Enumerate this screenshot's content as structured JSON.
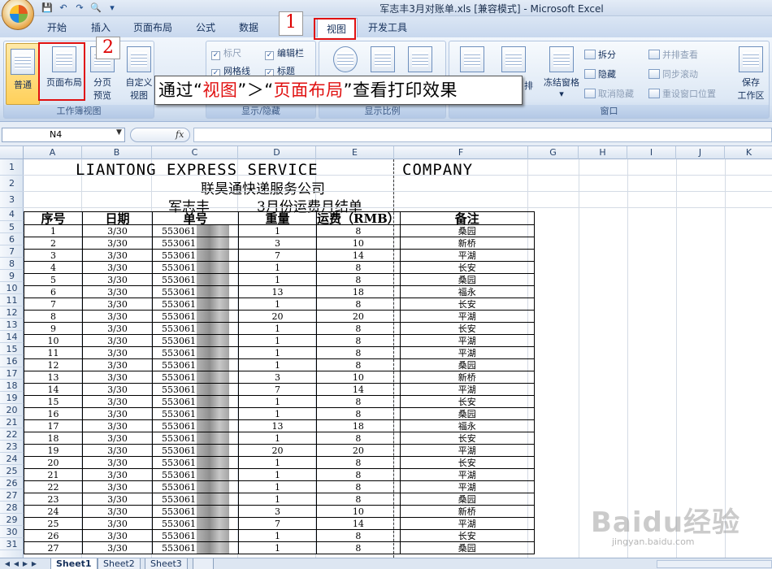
{
  "window": {
    "title": "军志丰3月对账单.xls  [兼容模式] - Microsoft Excel"
  },
  "quick_access": [
    "save-icon",
    "undo-icon",
    "redo-icon",
    "print-preview-icon"
  ],
  "tabs": [
    {
      "label": "开始"
    },
    {
      "label": "插入"
    },
    {
      "label": "页面布局"
    },
    {
      "label": "公式"
    },
    {
      "label": "数据"
    },
    {
      "label": "视图",
      "active": true
    },
    {
      "label": "开发工具"
    }
  ],
  "ribbon": {
    "groups": {
      "workbook_views": "工作簿视图",
      "show_hide": "显示/隐藏",
      "zoom": "显示比例",
      "window": "窗口"
    },
    "normal": "普通",
    "page_layout": "页面布局",
    "page_break_1": "分页",
    "page_break_2": "预览",
    "custom_1": "自定义",
    "custom_2": "视图",
    "ruler": "标尺",
    "formula_bar": "编辑栏",
    "gridlines": "网格线",
    "headings": "标题",
    "freeze": "冻结窗格",
    "arrange": "排",
    "split": "拆分",
    "hide": "隐藏",
    "unhide": "取消隐藏",
    "side_by_side": "并排查看",
    "sync_scroll": "同步滚动",
    "reset_pos": "重设窗口位置",
    "save_1": "保存",
    "save_2": "工作区"
  },
  "callouts": {
    "step1": "1",
    "step2": "2",
    "banner_pre": "通过“",
    "banner_hl1": "视图",
    "banner_mid": "”＞“",
    "banner_hl2": "页面布局",
    "banner_post": "”查看打印效果"
  },
  "formula_bar": {
    "name_box": "N4",
    "fx": "fx"
  },
  "columns": [
    "A",
    "B",
    "C",
    "D",
    "E",
    "F",
    "G",
    "H",
    "I",
    "J",
    "K"
  ],
  "sheet": {
    "title_en_left": "LIANTONG   EXPRESS   SERVICE",
    "title_en_right": "COMPANY",
    "title_cn": "联昊通快递服务公司",
    "subtitle_name": "军志丰",
    "subtitle_month": "3月份运费月结单",
    "headers": [
      "序号",
      "日期",
      "单号",
      "重量",
      "运费（RMB）",
      "备注"
    ],
    "rows": [
      [
        "1",
        "3/30",
        "553061",
        "1",
        "8",
        "桑园"
      ],
      [
        "2",
        "3/30",
        "553061",
        "3",
        "10",
        "新桥"
      ],
      [
        "3",
        "3/30",
        "553061",
        "7",
        "14",
        "平湖"
      ],
      [
        "4",
        "3/30",
        "553061",
        "1",
        "8",
        "长安"
      ],
      [
        "5",
        "3/30",
        "553061",
        "1",
        "8",
        "桑园"
      ],
      [
        "6",
        "3/30",
        "553061",
        "13",
        "18",
        "福永"
      ],
      [
        "7",
        "3/30",
        "553061",
        "1",
        "8",
        "长安"
      ],
      [
        "8",
        "3/30",
        "553061",
        "20",
        "20",
        "平湖"
      ],
      [
        "9",
        "3/30",
        "553061",
        "1",
        "8",
        "长安"
      ],
      [
        "10",
        "3/30",
        "553061",
        "1",
        "8",
        "平湖"
      ],
      [
        "11",
        "3/30",
        "553061",
        "1",
        "8",
        "平湖"
      ],
      [
        "12",
        "3/30",
        "553061",
        "1",
        "8",
        "桑园"
      ],
      [
        "13",
        "3/30",
        "553061",
        "3",
        "10",
        "新桥"
      ],
      [
        "14",
        "3/30",
        "553061",
        "7",
        "14",
        "平湖"
      ],
      [
        "15",
        "3/30",
        "553061",
        "1",
        "8",
        "长安"
      ],
      [
        "16",
        "3/30",
        "553061",
        "1",
        "8",
        "桑园"
      ],
      [
        "17",
        "3/30",
        "553061",
        "13",
        "18",
        "福永"
      ],
      [
        "18",
        "3/30",
        "553061",
        "1",
        "8",
        "长安"
      ],
      [
        "19",
        "3/30",
        "553061",
        "20",
        "20",
        "平湖"
      ],
      [
        "20",
        "3/30",
        "553061",
        "1",
        "8",
        "长安"
      ],
      [
        "21",
        "3/30",
        "553061",
        "1",
        "8",
        "平湖"
      ],
      [
        "22",
        "3/30",
        "553061",
        "1",
        "8",
        "平湖"
      ],
      [
        "23",
        "3/30",
        "553061",
        "1",
        "8",
        "桑园"
      ],
      [
        "24",
        "3/30",
        "553061",
        "3",
        "10",
        "新桥"
      ],
      [
        "25",
        "3/30",
        "553061",
        "7",
        "14",
        "平湖"
      ],
      [
        "26",
        "3/30",
        "553061",
        "1",
        "8",
        "长安"
      ],
      [
        "27",
        "3/30",
        "553061",
        "1",
        "8",
        "桑园"
      ]
    ]
  },
  "sheet_tabs": [
    "Sheet1",
    "Sheet2",
    "Sheet3"
  ],
  "watermark": {
    "logo": "Baidu经验",
    "url": "jingyan.baidu.com"
  },
  "colors": {
    "callout_red": "#e01010",
    "ribbon_blue": "#dbe6f4"
  }
}
